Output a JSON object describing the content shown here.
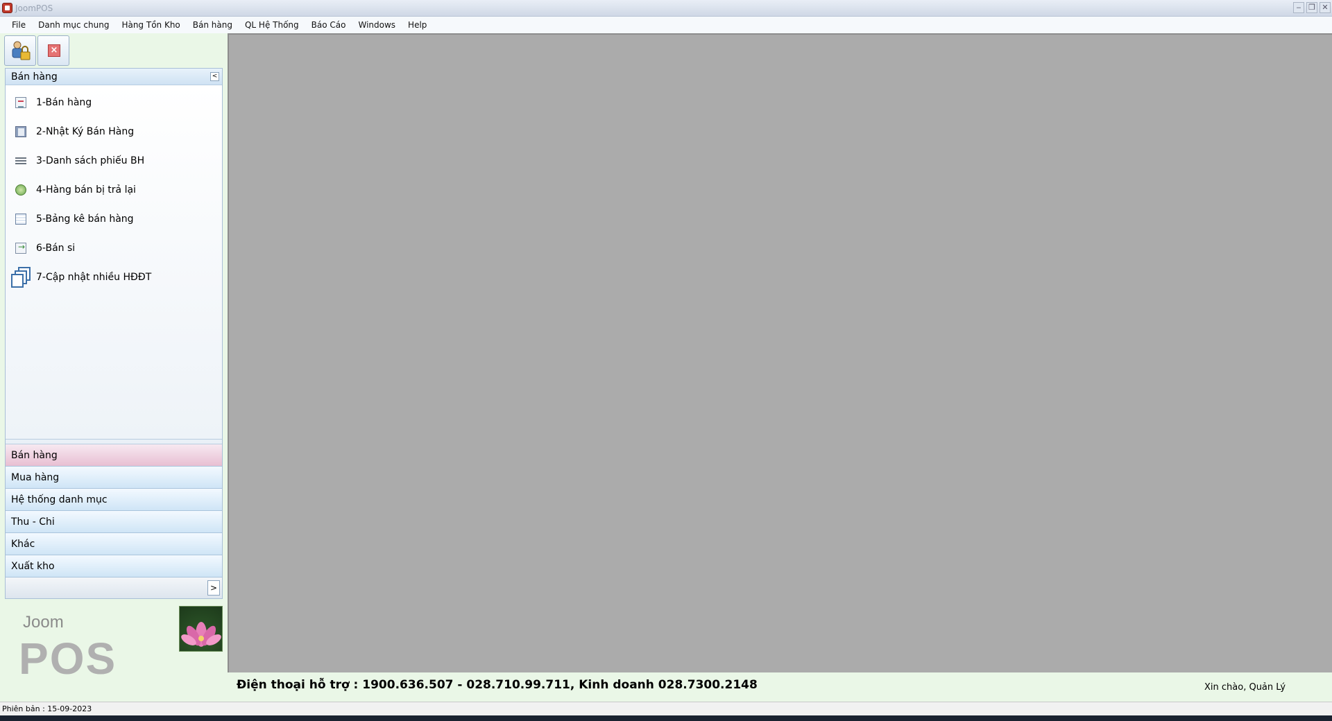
{
  "window": {
    "title": "JoomPOS",
    "controls": [
      "minimize-icon",
      "restore-icon",
      "close-icon"
    ]
  },
  "menu": [
    "File",
    "Danh mục chung",
    "Hàng Tồn Kho",
    "Bán hàng",
    "QL Hệ Thống",
    "Báo Cáo",
    "Windows",
    "Help"
  ],
  "toolbar": {
    "buttons": [
      {
        "icon": "user-lock-icon"
      },
      {
        "icon": "close-icon"
      }
    ]
  },
  "sidebar": {
    "section_title": "Bán hàng",
    "items": [
      {
        "label": "1-Bán hàng",
        "icon": "sales-doc-icon"
      },
      {
        "label": "2-Nhật Ký Bán Hàng",
        "icon": "journal-icon"
      },
      {
        "label": "3-Danh sách phiếu BH",
        "icon": "list-icon"
      },
      {
        "label": "4-Hàng bán bị trả lại",
        "icon": "return-icon"
      },
      {
        "label": "5-Bảng kê bán hàng",
        "icon": "sheet-icon"
      },
      {
        "label": "6-Bán si",
        "icon": "wholesale-icon"
      },
      {
        "label": "7-Cập nhật nhiều HĐĐT",
        "icon": "multi-document-icon"
      }
    ],
    "nav": [
      {
        "label": "Bán hàng",
        "active": true
      },
      {
        "label": "Mua hàng",
        "active": false
      },
      {
        "label": "Hệ thống danh mục",
        "active": false
      },
      {
        "label": "Thu - Chi",
        "active": false
      },
      {
        "label": "Khác",
        "active": false
      },
      {
        "label": "Xuất kho",
        "active": false
      }
    ]
  },
  "logo": {
    "line1": "Joom",
    "line2": "POS"
  },
  "footer": {
    "support": "Điện thoại hỗ trợ : 1900.636.507 - 028.710.99.711, Kinh doanh 028.7300.2148",
    "greeting": "Xin chào, Quản Lý"
  },
  "status": {
    "version": "Phiên bản : 15-09-2023"
  }
}
